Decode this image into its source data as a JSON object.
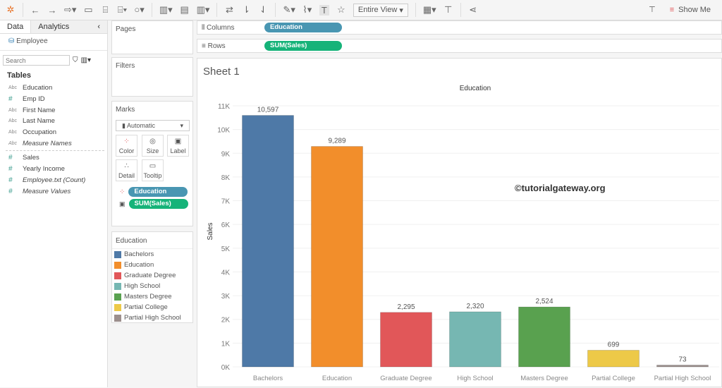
{
  "toolbar": {
    "view_select": "Entire View",
    "show_me": "Show Me",
    "icons": [
      "tableau-logo-icon",
      "undo-icon",
      "redo-icon",
      "replay-icon",
      "save-icon",
      "new-datasource-icon",
      "pause-icon",
      "refresh-icon",
      "new-worksheet-icon",
      "duplicate-icon",
      "clear-icon",
      "swap-icon",
      "sort-asc-icon",
      "sort-desc-icon",
      "highlight-icon",
      "annotate-icon",
      "labels-icon",
      "pin-icon",
      "fit-icon",
      "presentation-icon",
      "share-icon",
      "tooltip-icon"
    ]
  },
  "left": {
    "tabs": [
      "Data",
      "Analytics"
    ],
    "datasource": "Employee",
    "search_placeholder": "Search",
    "tables_label": "Tables",
    "dimensions": [
      {
        "type": "Abc",
        "name": "Education"
      },
      {
        "type": "#",
        "name": "Emp ID"
      },
      {
        "type": "Abc",
        "name": "First Name"
      },
      {
        "type": "Abc",
        "name": "Last Name"
      },
      {
        "type": "Abc",
        "name": "Occupation"
      },
      {
        "type": "Abc",
        "name": "Measure Names"
      }
    ],
    "measures": [
      {
        "type": "#",
        "name": "Sales"
      },
      {
        "type": "#",
        "name": "Yearly Income"
      },
      {
        "type": "#",
        "name": "Employee.txt (Count)"
      },
      {
        "type": "#",
        "name": "Measure Values"
      }
    ]
  },
  "cards": {
    "pages": "Pages",
    "filters": "Filters",
    "marks": "Marks",
    "mark_type": "Automatic",
    "buttons": [
      "Color",
      "Size",
      "Label",
      "Detail",
      "Tooltip"
    ],
    "mark_pills": [
      "Education",
      "SUM(Sales)"
    ]
  },
  "shelves": {
    "columns_label": "Columns",
    "columns_pill": "Education",
    "rows_label": "Rows",
    "rows_pill": "SUM(Sales)"
  },
  "legend": {
    "title": "Education"
  },
  "sheet": {
    "title": "Sheet 1",
    "watermark": "©tutorialgateway.org"
  },
  "chart_data": {
    "type": "bar",
    "title": "Education",
    "xlabel": "",
    "ylabel": "Sales",
    "ylim": [
      0,
      11000
    ],
    "yticks": [
      "0K",
      "1K",
      "2K",
      "3K",
      "4K",
      "5K",
      "6K",
      "7K",
      "8K",
      "9K",
      "10K",
      "11K"
    ],
    "categories": [
      "Bachelors",
      "Education",
      "Graduate Degree",
      "High School",
      "Masters Degree",
      "Partial College",
      "Partial High School"
    ],
    "values": [
      10597,
      9289,
      2295,
      2320,
      2524,
      699,
      73
    ],
    "labels": [
      "10,597",
      "9,289",
      "2,295",
      "2,320",
      "2,524",
      "699",
      "73"
    ],
    "colors": [
      "#4e79a7",
      "#f28e2b",
      "#e15759",
      "#76b7b2",
      "#59a14f",
      "#edc948",
      "#9c8f8d"
    ],
    "grid": true,
    "legend": "left-panel"
  }
}
